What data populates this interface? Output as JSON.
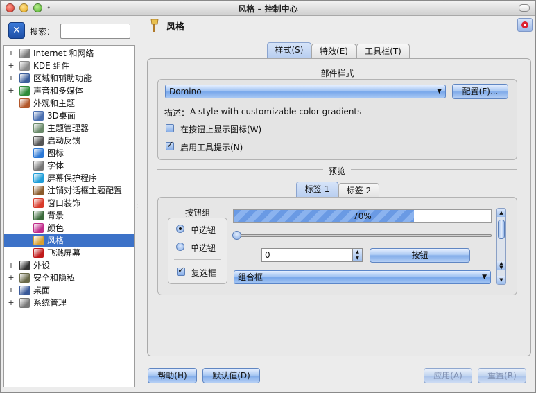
{
  "window": {
    "title": "风格 – 控制中心"
  },
  "search": {
    "label": "搜索：",
    "value": "",
    "placeholder": ""
  },
  "tree": [
    {
      "label": "Internet 和网络",
      "expander": "+",
      "icon": "globe-icon",
      "color": "#7a7a7a",
      "indent": 0
    },
    {
      "label": "KDE 组件",
      "expander": "+",
      "icon": "kde-components-icon",
      "color": "#8a8a8a",
      "indent": 0
    },
    {
      "label": "区域和辅助功能",
      "expander": "+",
      "icon": "region-icon",
      "color": "#3b5e9b",
      "indent": 0
    },
    {
      "label": "声音和多媒体",
      "expander": "+",
      "icon": "multimedia-icon",
      "color": "#2f8c3a",
      "indent": 0
    },
    {
      "label": "外观和主题",
      "expander": "−",
      "icon": "appearance-icon",
      "color": "#b3572a",
      "indent": 0
    },
    {
      "label": "3D桌面",
      "expander": "",
      "icon": "desktop-3d-icon",
      "color": "#4a6fb0",
      "indent": 1
    },
    {
      "label": "主题管理器",
      "expander": "",
      "icon": "theme-manager-icon",
      "color": "#6a8a6a",
      "indent": 1
    },
    {
      "label": "启动反馈",
      "expander": "",
      "icon": "launch-feedback-icon",
      "color": "#555555",
      "indent": 1
    },
    {
      "label": "图标",
      "expander": "",
      "icon": "icons-icon",
      "color": "#2b78d6",
      "indent": 1
    },
    {
      "label": "字体",
      "expander": "",
      "icon": "fonts-icon",
      "color": "#777777",
      "indent": 1
    },
    {
      "label": "屏幕保护程序",
      "expander": "",
      "icon": "screensaver-icon",
      "color": "#1f9ed8",
      "indent": 1
    },
    {
      "label": "注销对话框主题配置",
      "expander": "",
      "icon": "logout-theme-icon",
      "color": "#8a5a2a",
      "indent": 1
    },
    {
      "label": "窗口装饰",
      "expander": "",
      "icon": "window-decoration-icon",
      "color": "#d83a2a",
      "indent": 1
    },
    {
      "label": "背景",
      "expander": "",
      "icon": "background-icon",
      "color": "#3a6a3a",
      "indent": 1
    },
    {
      "label": "颜色",
      "expander": "",
      "icon": "colors-icon",
      "color": "#c02a8a",
      "indent": 1
    },
    {
      "label": "风格",
      "expander": "",
      "icon": "style-icon",
      "color": "#d8a030",
      "indent": 1,
      "selected": true
    },
    {
      "label": "飞溅屏幕",
      "expander": "",
      "icon": "splash-screen-icon",
      "color": "#c01a1a",
      "indent": 1
    },
    {
      "label": "外设",
      "expander": "+",
      "icon": "peripherals-icon",
      "color": "#333333",
      "indent": 0
    },
    {
      "label": "安全和隐私",
      "expander": "+",
      "icon": "security-icon",
      "color": "#6a6a4a",
      "indent": 0
    },
    {
      "label": "桌面",
      "expander": "+",
      "icon": "desktop-icon",
      "color": "#3a5a9a",
      "indent": 0
    },
    {
      "label": "系统管理",
      "expander": "+",
      "icon": "system-admin-icon",
      "color": "#777777",
      "indent": 0
    }
  ],
  "header": {
    "title": "风格"
  },
  "tabs": [
    {
      "label": "样式(S)",
      "active": true
    },
    {
      "label": "特效(E)",
      "active": false
    },
    {
      "label": "工具栏(T)",
      "active": false
    }
  ],
  "widget_style": {
    "group_title": "部件样式",
    "combo_value": "Domino",
    "configure_label": "配置(F)...",
    "desc_label": "描述：",
    "desc_value": "A style with customizable color gradients",
    "checkbox_icons_label": "在按钮上显示图标(W)",
    "checkbox_icons_checked": false,
    "checkbox_tooltips_label": "启用工具提示(N)",
    "checkbox_tooltips_checked": true
  },
  "preview": {
    "title": "预览",
    "tabs": [
      {
        "label": "标签 1",
        "active": true
      },
      {
        "label": "标签 2",
        "active": false
      }
    ],
    "group_title": "按钮组",
    "radio1_label": "单选钮",
    "radio2_label": "单选钮",
    "checkbox_label": "复选框",
    "progress_value": 70,
    "progress_text": "70%",
    "slider_value": 0,
    "spin_value": "0",
    "button_label": "按钮",
    "combo_value": "组合框"
  },
  "footer": {
    "help_label": "帮助(H)",
    "defaults_label": "默认值(D)",
    "apply_label": "应用(A)",
    "reset_label": "重置(R)"
  },
  "colors": {
    "accent": "#3c72c8",
    "button_gradient": "#80abe9"
  }
}
